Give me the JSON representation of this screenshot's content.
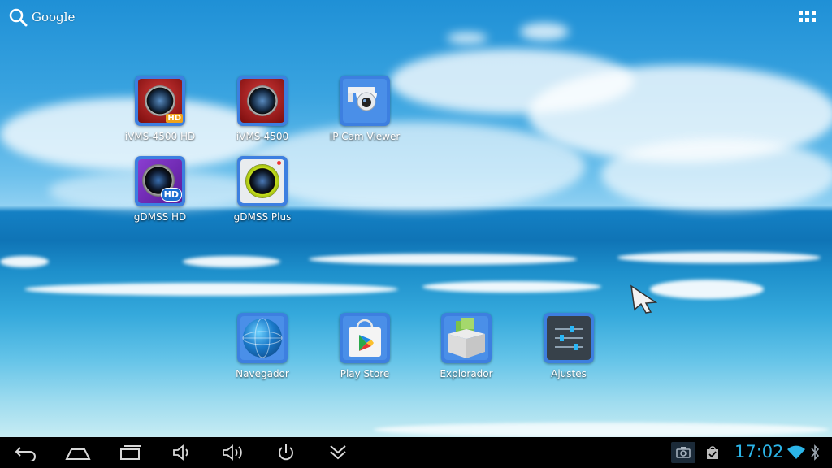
{
  "search": {
    "label": "Google"
  },
  "home": {
    "apps": [
      {
        "label": "iVMS-4500 HD"
      },
      {
        "label": "iVMS-4500"
      },
      {
        "label": "IP Cam Viewer"
      },
      {
        "label": "gDMSS HD"
      },
      {
        "label": "gDMSS Plus"
      }
    ],
    "dock": [
      {
        "label": "Navegador"
      },
      {
        "label": "Play Store"
      },
      {
        "label": "Explorador"
      },
      {
        "label": "Ajustes"
      }
    ]
  },
  "icons": {
    "ivms_hd_badge": "HD",
    "gdmss_hd_badge": "HD"
  },
  "status": {
    "time": "17:02"
  },
  "colors": {
    "clock": "#2cb5e8",
    "navbar": "#000000"
  }
}
